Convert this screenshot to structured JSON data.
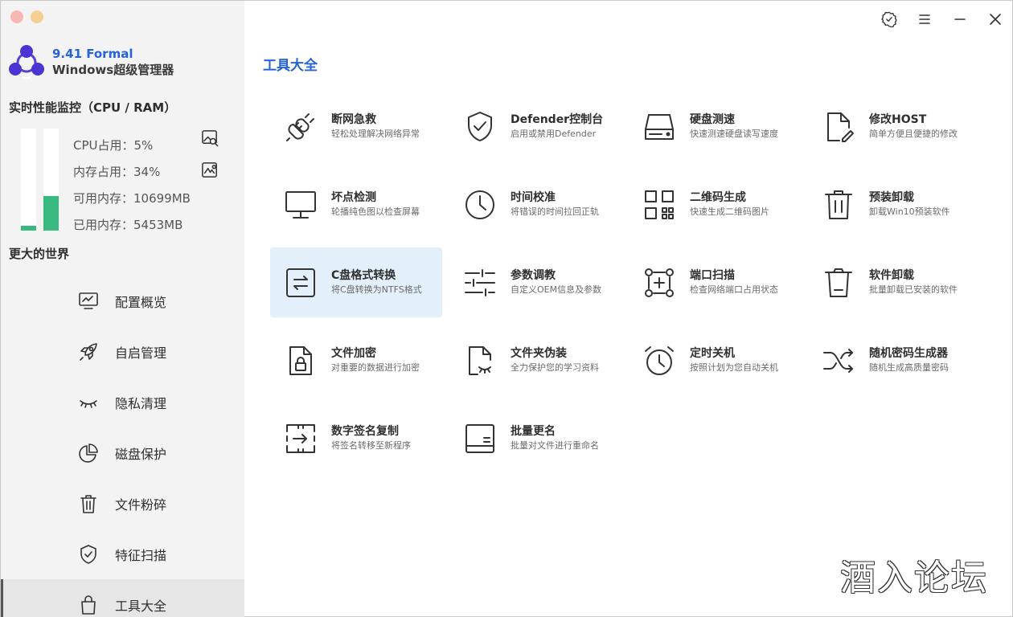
{
  "app": {
    "version": "9.41 Formal",
    "name": "Windows超级管理器"
  },
  "monitor": {
    "title": "实时性能监控（CPU / RAM）",
    "cpu_label": "CPU占用：5%",
    "ram_label": "内存占用：34%",
    "available_label": "可用内存：10699MB",
    "used_label": "已用内存：5453MB",
    "cpu_usage_percent": 5,
    "ram_usage_percent": 34,
    "bar_color": "#37b980"
  },
  "sidebar": {
    "section_title": "更大的世界",
    "items": [
      {
        "label": "配置概览",
        "icon": "monitor-chart-icon"
      },
      {
        "label": "自启管理",
        "icon": "rocket-icon"
      },
      {
        "label": "隐私清理",
        "icon": "closed-eye-icon"
      },
      {
        "label": "磁盘保护",
        "icon": "pie-chart-icon"
      },
      {
        "label": "文件粉碎",
        "icon": "trash-icon"
      },
      {
        "label": "特征扫描",
        "icon": "shield-check-icon"
      },
      {
        "label": "工具大全",
        "icon": "bag-icon",
        "active": true
      }
    ]
  },
  "main": {
    "title": "工具大全",
    "accent_color": "#2563d6",
    "tools": [
      {
        "name": "断网急救",
        "desc": "轻松处理解决网络异常",
        "icon": "plug-icon"
      },
      {
        "name": "Defender控制台",
        "desc": "启用或禁用Defender",
        "icon": "shield-check-icon"
      },
      {
        "name": "硬盘测速",
        "desc": "快速测速硬盘读写速度",
        "icon": "hard-drive-icon"
      },
      {
        "name": "修改HOST",
        "desc": "简单方便且便捷的修改",
        "icon": "file-edit-icon"
      },
      {
        "name": "坏点检测",
        "desc": "轮播纯色图以检查屏幕",
        "icon": "monitor-icon"
      },
      {
        "name": "时间校准",
        "desc": "将错误的时间拉回正轨",
        "icon": "clock-icon"
      },
      {
        "name": "二维码生成",
        "desc": "快速生成二维码图片",
        "icon": "qr-code-icon"
      },
      {
        "name": "预装卸载",
        "desc": "卸载Win10预装软件",
        "icon": "trash-icon"
      },
      {
        "name": "C盘格式转换",
        "desc": "将C盘转换为NTFS格式",
        "icon": "swap-box-icon",
        "selected": true
      },
      {
        "name": "参数调教",
        "desc": "自定义OEM信息及参数",
        "icon": "sliders-icon"
      },
      {
        "name": "端口扫描",
        "desc": "检查网络端口占用状态",
        "icon": "port-scan-icon"
      },
      {
        "name": "软件卸载",
        "desc": "批量卸载已安装的软件",
        "icon": "trash-can-icon"
      },
      {
        "name": "文件加密",
        "desc": "对重要的数据进行加密",
        "icon": "file-lock-icon"
      },
      {
        "name": "文件夹伪装",
        "desc": "全力保护您的学习资料",
        "icon": "file-hidden-icon"
      },
      {
        "name": "定时关机",
        "desc": "按照计划为您自动关机",
        "icon": "alarm-clock-icon"
      },
      {
        "name": "随机密码生成器",
        "desc": "随机生成高质量密码",
        "icon": "shuffle-icon"
      },
      {
        "name": "数字签名复制",
        "desc": "将签名转移至新程序",
        "icon": "signature-copy-icon"
      },
      {
        "name": "批量更名",
        "desc": "批量对文件进行重命名",
        "icon": "rename-icon"
      }
    ]
  },
  "watermark": "酒入论坛"
}
